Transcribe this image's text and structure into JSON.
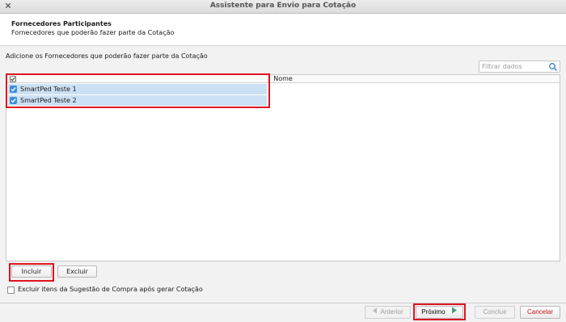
{
  "window": {
    "title": "Assistente para Envio para Cotação",
    "close_glyph": "✕"
  },
  "header": {
    "title": "Fornecedores Participantes",
    "subtitle": "Fornecedores que poderão fazer parte da Cotação"
  },
  "main": {
    "instruction": "Adicione os Fornecedores que poderão fazer parte da Cotação",
    "search": {
      "placeholder": "Filtrar dados",
      "value": ""
    },
    "table": {
      "column_header": "Nome",
      "rows": [
        {
          "name": "SmartPed Teste 1",
          "checked": true
        },
        {
          "name": "SmartPed Teste 2",
          "checked": true
        }
      ]
    },
    "buttons": {
      "include": "Incluir",
      "exclude": "Excluir"
    },
    "option": {
      "label": "Excluir itens da Sugestão de Compra após gerar Cotação",
      "checked": false
    }
  },
  "footer": {
    "previous": "Anterior",
    "next": "Próximo",
    "finish": "Concluir",
    "cancel": "Cancelar"
  },
  "colors": {
    "highlight": "#e0141e",
    "selected_row": "#cce0f5",
    "checkbox": "#3d8fd8",
    "next_arrow": "#3aa37a"
  }
}
